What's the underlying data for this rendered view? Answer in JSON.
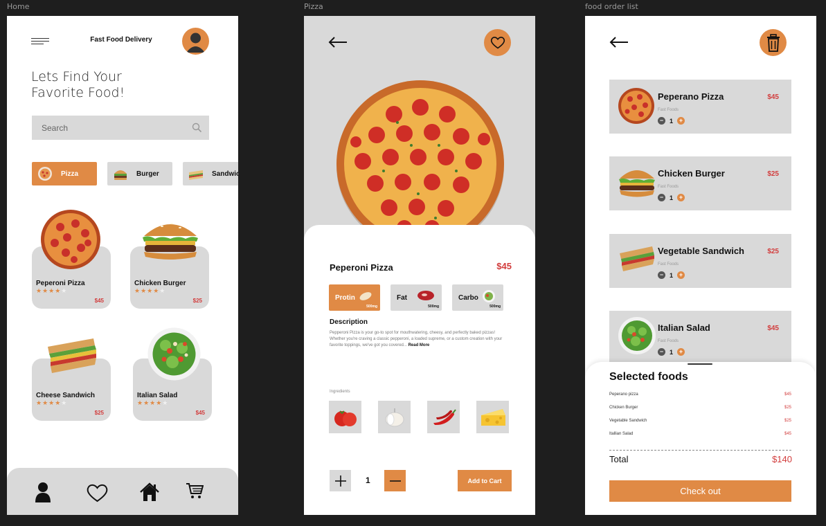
{
  "frames": {
    "home_label": "Home",
    "pizza_label": "Pizza",
    "orders_label": "food order list"
  },
  "home": {
    "title": "Fast Food Delivery",
    "headline_line1": "Lets Find Your",
    "headline_line2": "Favorite Food!",
    "search_placeholder": "Search",
    "categories": [
      {
        "label": "Pizza"
      },
      {
        "label": "Burger"
      },
      {
        "label": "Sandwich"
      }
    ],
    "foods": [
      {
        "name": "Peperoni Pizza",
        "price": "$45",
        "rating": 4
      },
      {
        "name": "Chicken Burger",
        "price": "$25",
        "rating": 4
      },
      {
        "name": "Cheese Sandwich",
        "price": "$25",
        "rating": 4
      },
      {
        "name": "Italian Salad",
        "price": "$45",
        "rating": 4
      }
    ]
  },
  "pizza": {
    "title": "Peperoni Pizza",
    "price": "$45",
    "nutrients": [
      {
        "label": "Protin",
        "value": "500mg"
      },
      {
        "label": "Fat",
        "value": "500mg"
      },
      {
        "label": "Carbo",
        "value": "500mg"
      }
    ],
    "description_heading": "Description",
    "description": "Pepperoni Pizza is your go-to spot for mouthwatering, cheesy, and perfectly baked pizzas! Whether you're craving a classic pepperoni, a loaded supreme, or a custom creation with your favorite toppings, we've got you covered...",
    "read_more": "Read More",
    "ingredients_heading": "Ingredients",
    "quantity": "1",
    "add_to_cart": "Add to Cart"
  },
  "orders": {
    "items": [
      {
        "name": "Peperano Pizza",
        "category": "Fast Foods",
        "qty": "1",
        "price": "$45"
      },
      {
        "name": "Chicken Burger",
        "category": "Fast Foods",
        "qty": "1",
        "price": "$25"
      },
      {
        "name": "Vegetable Sandwich",
        "category": "Fast Foods",
        "qty": "1",
        "price": "$25"
      },
      {
        "name": "Italian Salad",
        "category": "Fast Foods",
        "qty": "1",
        "price": "$45"
      }
    ],
    "selected_title": "Selected foods",
    "selected": [
      {
        "name": "Peperano pizza",
        "price": "$45"
      },
      {
        "name": "Chicken Burger",
        "price": "$25"
      },
      {
        "name": "Vegetable Sandwich",
        "price": "$25"
      },
      {
        "name": "Itallian Salad",
        "price": "$45"
      }
    ],
    "total_label": "Total",
    "total_value": "$140",
    "checkout": "Check out"
  },
  "colors": {
    "accent": "#e08a45",
    "price": "#d23c3c",
    "card": "#d9d9d9"
  }
}
